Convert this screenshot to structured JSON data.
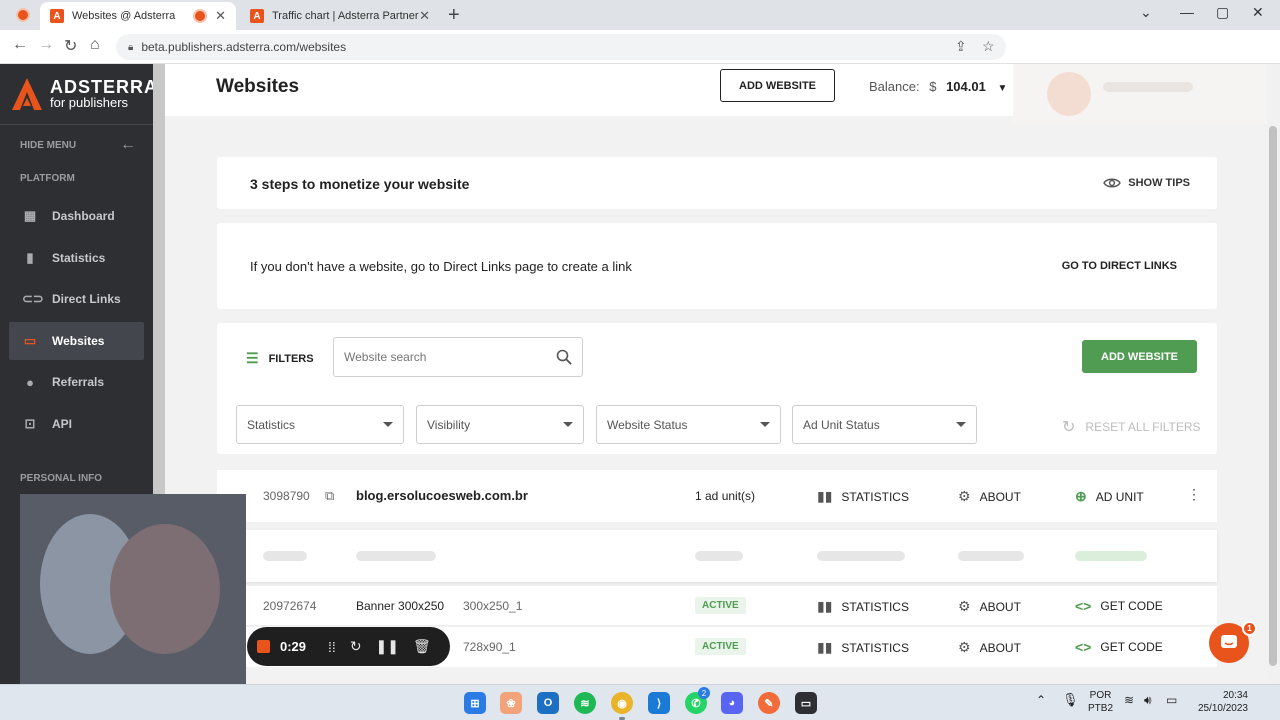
{
  "browser": {
    "tabs": [
      {
        "title": "Websites @ Adsterra",
        "favicon": "A"
      },
      {
        "title": "Traffic chart | Adsterra Partners",
        "favicon": "A"
      }
    ],
    "url": "beta.publishers.adsterra.com/websites"
  },
  "sidebar": {
    "logo_line1": "ADSTERRA",
    "logo_line2": "for publishers",
    "hide_menu": "HIDE MENU",
    "platform": "PLATFORM",
    "personal_info": "PERSONAL INFO",
    "items": [
      {
        "label": "Dashboard",
        "icon": "grid-icon"
      },
      {
        "label": "Statistics",
        "icon": "bar-chart-icon"
      },
      {
        "label": "Direct Links",
        "icon": "link-icon"
      },
      {
        "label": "Websites",
        "icon": "monitor-icon",
        "active": true
      },
      {
        "label": "Referrals",
        "icon": "people-icon"
      },
      {
        "label": "API",
        "icon": "terminal-icon"
      }
    ]
  },
  "header": {
    "title": "Websites",
    "add_website": "ADD WEBSITE",
    "balance_label": "Balance:",
    "currency": "$",
    "balance_value": "104.01"
  },
  "steps": {
    "title": "3 steps to monetize your website",
    "show_tips": "SHOW TIPS"
  },
  "direct": {
    "text": "If you don't have a website, go to Direct Links page to create a link",
    "button": "GO TO DIRECT LINKS"
  },
  "filters": {
    "label": "FILTERS",
    "search_placeholder": "Website search",
    "add_website": "ADD WEBSITE",
    "selects": [
      "Statistics",
      "Visibility",
      "Website Status",
      "Ad Unit Status"
    ],
    "reset": "RESET ALL FILTERS"
  },
  "website_row": {
    "id": "3098790",
    "domain": "blog.ersolucoesweb.com.br",
    "ad_units": "1 ad unit(s)",
    "statistics": "STATISTICS",
    "about": "ABOUT",
    "ad_unit": "AD UNIT"
  },
  "ad_units": [
    {
      "id": "20972674",
      "name": "Banner 300x250",
      "size": "300x250_1",
      "status": "ACTIVE",
      "statistics": "STATISTICS",
      "about": "ABOUT",
      "code": "GET CODE"
    },
    {
      "id": "",
      "name": "",
      "size": "728x90_1",
      "status": "ACTIVE",
      "statistics": "STATISTICS",
      "about": "ABOUT",
      "code": "GET CODE"
    }
  ],
  "recorder": {
    "time": "0:29"
  },
  "chat": {
    "badge": "1"
  },
  "taskbar": {
    "lang1": "POR",
    "lang2": "PTB2",
    "time": "20:34",
    "date": "25/10/2023",
    "whatsapp_badge": "2"
  },
  "colors": {
    "brand": "#e8541c",
    "green": "#4f9c52",
    "sidebar": "#2d2f33"
  }
}
